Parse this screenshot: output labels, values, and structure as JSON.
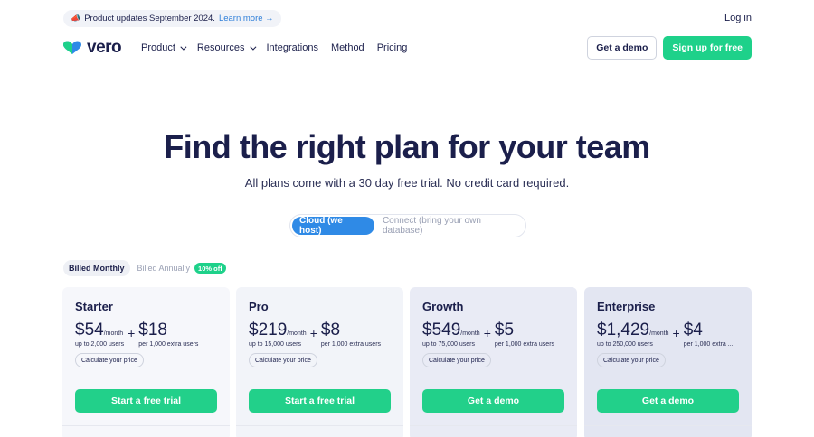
{
  "announcement": {
    "emoji": "📣",
    "text": "Product updates September 2024.",
    "link": "Learn more →"
  },
  "header": {
    "login": "Log in"
  },
  "logo": {
    "text": "vero"
  },
  "nav": {
    "items": [
      {
        "label": "Product",
        "dropdown": true
      },
      {
        "label": "Resources",
        "dropdown": true
      },
      {
        "label": "Integrations",
        "dropdown": false
      },
      {
        "label": "Method",
        "dropdown": false
      },
      {
        "label": "Pricing",
        "dropdown": false
      }
    ],
    "demo_label": "Get a demo",
    "signup_label": "Sign up for free"
  },
  "hero": {
    "title": "Find the right plan for your team",
    "subtitle": "All plans come with a 30 day free trial. No credit card required."
  },
  "hosting_toggle": {
    "active": "Cloud (we host)",
    "inactive": "Connect (bring your own database)"
  },
  "billing": {
    "monthly": "Billed Monthly",
    "annual": "Billed Annually",
    "discount": "10% off"
  },
  "plans": [
    {
      "name": "Starter",
      "price": "$54",
      "period": "/month",
      "users": "up to 2,000 users",
      "plus": "+",
      "extra_price": "$18",
      "extra_note": "per 1,000 extra users",
      "calc": "Calculate your price",
      "cta": "Start a free trial"
    },
    {
      "name": "Pro",
      "price": "$219",
      "period": "/month",
      "users": "up to 15,000 users",
      "plus": "+",
      "extra_price": "$8",
      "extra_note": "per 1,000 extra users",
      "calc": "Calculate your price",
      "cta": "Start a free trial"
    },
    {
      "name": "Growth",
      "price": "$549",
      "period": "/month",
      "users": "up to 75,000 users",
      "plus": "+",
      "extra_price": "$5",
      "extra_note": "per 1,000 extra users",
      "calc": "Calculate your price",
      "cta": "Get a demo"
    },
    {
      "name": "Enterprise",
      "price": "$1,429",
      "period": "/month",
      "users": "up to 250,000 users",
      "plus": "+",
      "extra_price": "$4",
      "extra_note": "per 1,000 extra ...",
      "calc": "Calculate your price",
      "cta": "Get a demo"
    }
  ],
  "colors": {
    "navy": "#1b1f4b",
    "green": "#1ed18a",
    "blue": "#2f8ae6",
    "link": "#2f7fd9"
  }
}
